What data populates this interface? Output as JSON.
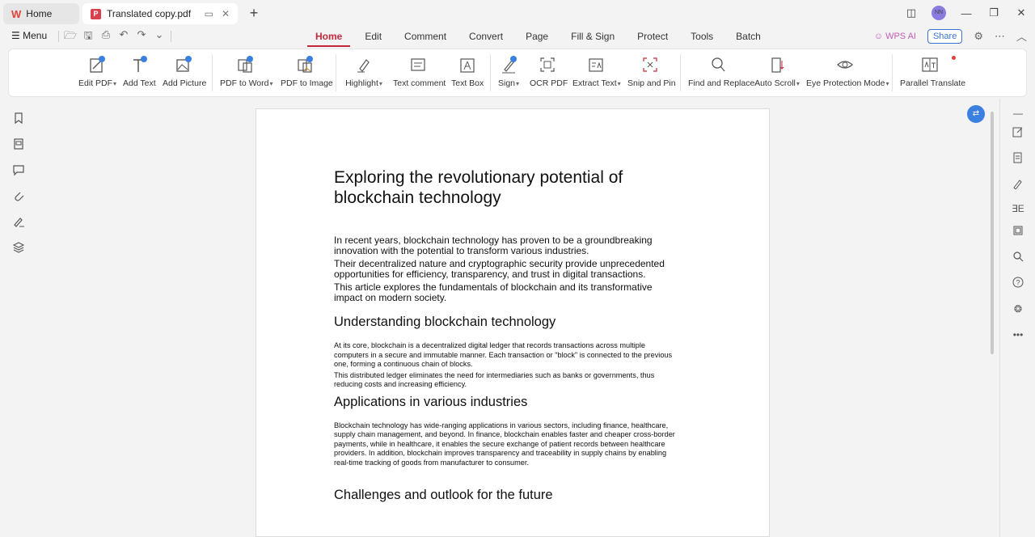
{
  "tabs": {
    "home_label": "Home",
    "doc_label": "Translated copy.pdf"
  },
  "window": {
    "avatar_initials": "NN"
  },
  "menubar": {
    "menu_label": "Menu",
    "tabs": [
      "Home",
      "Edit",
      "Comment",
      "Convert",
      "Page",
      "Fill & Sign",
      "Protect",
      "Tools",
      "Batch"
    ],
    "active_tab": "Home",
    "wps_ai_label": "WPS AI",
    "share_label": "Share"
  },
  "ribbon": {
    "edit_pdf": "Edit PDF",
    "add_text": "Add Text",
    "add_picture": "Add Picture",
    "pdf_to_word": "PDF to Word",
    "pdf_to_image": "PDF to Image",
    "highlight": "Highlight",
    "text_comment": "Text comment",
    "text_box": "Text Box",
    "sign": "Sign",
    "ocr_pdf": "OCR PDF",
    "extract_text": "Extract Text",
    "snip_and_pin": "Snip and Pin",
    "find_and_replace": "Find and Replace",
    "auto_scroll": "Auto Scroll",
    "eye_protection_mode": "Eye Protection Mode",
    "parallel_translate": "Parallel Translate"
  },
  "document": {
    "title": "Exploring the revolutionary potential of blockchain technology",
    "intro": [
      "In recent years, blockchain technology has proven to be a groundbreaking innovation with the potential to transform various industries.",
      "Their decentralized nature and cryptographic security provide unprecedented opportunities for efficiency, transparency, and trust in digital transactions.",
      "This article explores the fundamentals of blockchain and its transformative impact on modern society."
    ],
    "section1_heading": "Understanding blockchain technology",
    "section1_paragraphs": [
      "At its core, blockchain is a decentralized digital ledger that records transactions across multiple computers in a secure and immutable manner. Each transaction or \"block\" is connected to the previous one, forming a continuous chain of blocks.",
      "This distributed ledger eliminates the need for intermediaries such as banks or governments, thus reducing costs and increasing efficiency."
    ],
    "section2_heading": "Applications in various industries",
    "section2_paragraph": "Blockchain technology has wide-ranging applications in various sectors, including finance, healthcare, supply chain management, and beyond. In finance, blockchain enables faster and cheaper cross-border payments, while in healthcare, it enables the secure exchange of patient records between healthcare providers. In addition, blockchain improves transparency and traceability in supply chains by enabling real-time tracking of goods from manufacturer to consumer.",
    "section3_heading": "Challenges and outlook for the future"
  },
  "colors": {
    "accent": "#c4283b",
    "share_blue": "#3b74d6",
    "fab_blue": "#3b7fe0"
  }
}
